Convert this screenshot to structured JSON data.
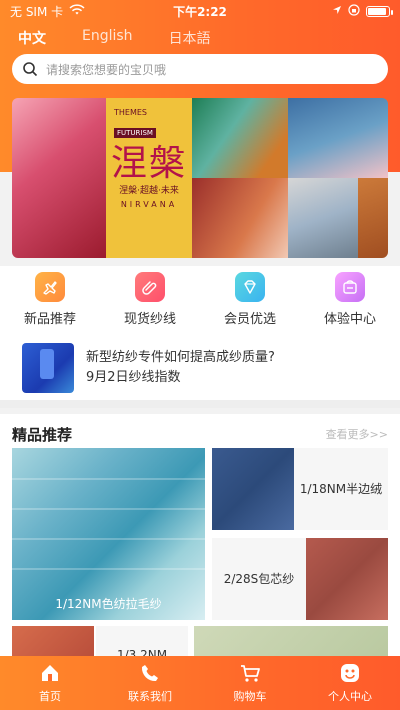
{
  "status_bar": {
    "carrier": "无 SIM 卡",
    "time": "下午2:22"
  },
  "lang_tabs": [
    {
      "label": "中文"
    },
    {
      "label": "English"
    },
    {
      "label": "日本語"
    }
  ],
  "search": {
    "placeholder": "请搜索您想要的宝贝哦"
  },
  "banner": {
    "title": "涅槃",
    "subtitle": "NIRVANA",
    "themes": "THEMES",
    "futurism": "FUTURISM",
    "tagline": "涅槃·超越·未来"
  },
  "categories": [
    {
      "label": "新品推荐",
      "icon": "airplane-icon"
    },
    {
      "label": "现货纱线",
      "icon": "paperclip-icon"
    },
    {
      "label": "会员优选",
      "icon": "diamond-icon"
    },
    {
      "label": "体验中心",
      "icon": "cart-box-icon"
    }
  ],
  "news": {
    "line1": "新型纺纱专件如何提高成纱质量?",
    "line2": "9月2日纱线指数"
  },
  "recommend": {
    "title": "精品推荐",
    "more": "查看更多>>",
    "products": [
      {
        "label": "1/12NM色纺拉毛纱"
      },
      {
        "label": "1/18NM半边绒"
      },
      {
        "label": "2/28S包芯纱"
      },
      {
        "label": "1/3.2NM"
      }
    ]
  },
  "tabbar": [
    {
      "label": "首页",
      "icon": "home-icon"
    },
    {
      "label": "联系我们",
      "icon": "phone-icon"
    },
    {
      "label": "购物车",
      "icon": "cart-icon"
    },
    {
      "label": "个人中心",
      "icon": "smile-icon"
    }
  ]
}
